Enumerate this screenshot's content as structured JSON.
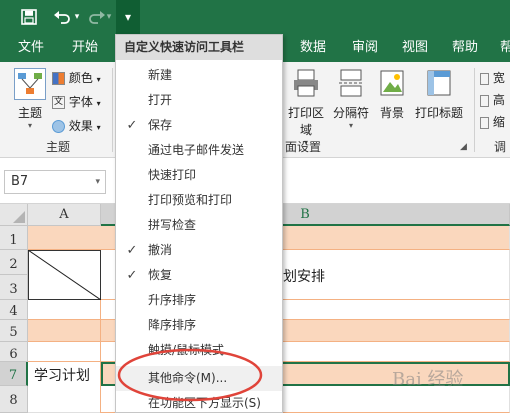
{
  "qat": {
    "save_icon": "save-icon",
    "undo_icon": "undo-icon",
    "redo_icon": "redo-icon",
    "customize_icon": "customize-arrow-icon"
  },
  "tabs": [
    "文件",
    "开始",
    "数据",
    "审阅",
    "视图",
    "帮助",
    "帮"
  ],
  "ribbon": {
    "theme_label": "主题",
    "colors_label": "颜色",
    "fonts_label": "字体",
    "effects_label": "效果",
    "group_theme": "主题",
    "print_area": "打印区域",
    "breaks": "分隔符",
    "background": "背景",
    "print_titles": "打印标题",
    "group_page_setup": "面设置",
    "right_label_1": "宽",
    "right_label_2": "高",
    "right_label_3": "缩",
    "right_group": "调"
  },
  "namebox": "B7",
  "columns": [
    "A",
    "B"
  ],
  "rows": [
    "1",
    "2",
    "3",
    "4",
    "5",
    "6",
    "7",
    "8"
  ],
  "cells": {
    "a7": "学习计划",
    "b2": "计划安排"
  },
  "colors": {
    "green": "#217346",
    "peach": "#fad7bd",
    "orange_border": "#f4b183",
    "red_circle": "#e0443a"
  },
  "menu": {
    "title": "自定义快速访问工具栏",
    "items": [
      {
        "label": "新建",
        "checked": false
      },
      {
        "label": "打开",
        "checked": false
      },
      {
        "label": "保存",
        "checked": true
      },
      {
        "label": "通过电子邮件发送",
        "checked": false
      },
      {
        "label": "快速打印",
        "checked": false
      },
      {
        "label": "打印预览和打印",
        "checked": false
      },
      {
        "label": "拼写检查",
        "checked": false
      },
      {
        "label": "撤消",
        "checked": true
      },
      {
        "label": "恢复",
        "checked": true
      },
      {
        "label": "升序排序",
        "checked": false
      },
      {
        "label": "降序排序",
        "checked": false
      },
      {
        "label": "触摸/鼠标模式",
        "checked": false
      }
    ],
    "more_commands": "其他命令(M)...",
    "show_below": "在功能区下方显示(S)"
  },
  "watermark": "Bai 经验"
}
